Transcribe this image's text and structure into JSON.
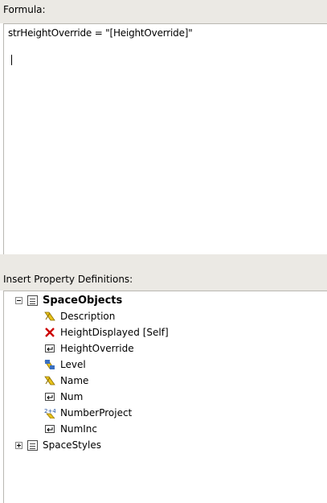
{
  "formula": {
    "label": "Formula:",
    "text": "strHeightOverride = \"[HeightOverride]\""
  },
  "insert": {
    "label": "Insert Property Definitions:"
  },
  "tree": {
    "root": {
      "label": "SpaceObjects",
      "expanded": true,
      "icon": "property-set-icon"
    },
    "children": [
      {
        "label": "Description",
        "icon": "text-property-icon"
      },
      {
        "label": "HeightDisplayed [Self]",
        "icon": "red-x-icon"
      },
      {
        "label": "HeightOverride",
        "icon": "manual-property-icon"
      },
      {
        "label": "Level",
        "icon": "location-property-icon"
      },
      {
        "label": "Name",
        "icon": "text-property-icon"
      },
      {
        "label": "Num",
        "icon": "manual-property-icon"
      },
      {
        "label": "NumberProject",
        "icon": "auto-increment-icon"
      },
      {
        "label": "NumInc",
        "icon": "manual-property-icon"
      }
    ],
    "second": {
      "label": "SpaceStyles",
      "expanded": false,
      "icon": "property-set-icon"
    }
  },
  "colors": {
    "band": "#ebe9e4",
    "border": "#b9b8b2",
    "red": "#cc0000",
    "yellow": "#e8c21a"
  }
}
